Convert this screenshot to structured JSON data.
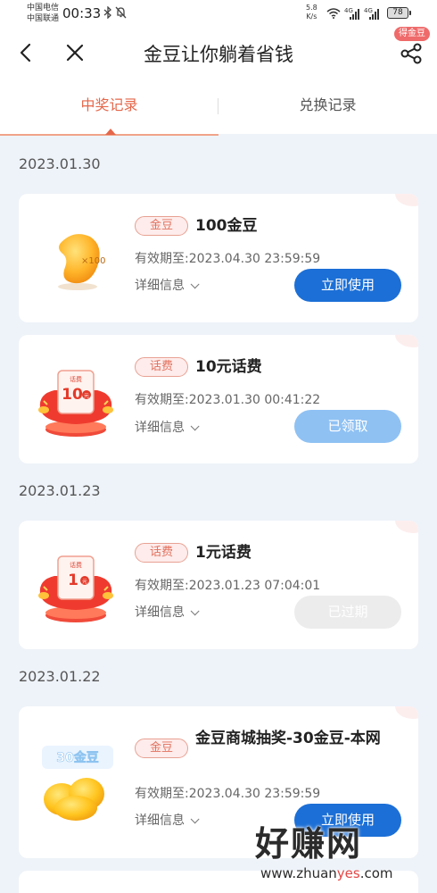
{
  "status_bar": {
    "carrier_1": "中国电信",
    "carrier_2": "中国联通",
    "time": "00:33",
    "net_speed_value": "5.8",
    "net_speed_unit": "K/s",
    "signal_1": "4G",
    "signal_2": "4G",
    "battery": "78"
  },
  "header": {
    "title": "金豆让你躺着省钱",
    "badge": "得金豆"
  },
  "tabs": [
    {
      "label": "中奖记录",
      "active": true
    },
    {
      "label": "兑换记录",
      "active": false
    }
  ],
  "groups": [
    {
      "date": "2023.01.30",
      "records": [
        {
          "tag": "金豆",
          "name": "100金豆",
          "expire_label": "有效期至:",
          "expire_time": "2023.04.30 23:59:59",
          "detail": "详细信息",
          "button": "立即使用",
          "image_text": "×100"
        },
        {
          "tag": "话费",
          "name": "10元话费",
          "expire_label": "有效期至:",
          "expire_time": "2023.01.30 00:41:22",
          "detail": "详细信息",
          "button": "已领取",
          "image_text": "10",
          "image_top_text": "话费",
          "image_unit": "元"
        }
      ]
    },
    {
      "date": "2023.01.23",
      "records": [
        {
          "tag": "话费",
          "name": "1元话费",
          "expire_label": "有效期至:",
          "expire_time": "2023.01.23 07:04:01",
          "detail": "详细信息",
          "button": "已过期",
          "image_text": "1",
          "image_top_text": "话费",
          "image_unit": "元"
        }
      ]
    },
    {
      "date": "2023.01.22",
      "records": [
        {
          "tag": "金豆",
          "name": "金豆商城抽奖-30金豆-本网",
          "expire_label": "有效期至:",
          "expire_time": "2023.04.30 23:59:59",
          "detail": "详细信息",
          "button": "立即使用",
          "image_text": "30金豆"
        }
      ]
    }
  ],
  "watermark": {
    "main": "好赚网",
    "sub_prefix": "www.zhuan",
    "sub_accent": "yes",
    "sub_suffix": ".com"
  },
  "colors": {
    "accent": "#e5674a",
    "primary_button": "#1c6fd6",
    "claimed_button": "#8fc1f3",
    "expired_button": "#ececec",
    "background": "#eef3f9"
  }
}
